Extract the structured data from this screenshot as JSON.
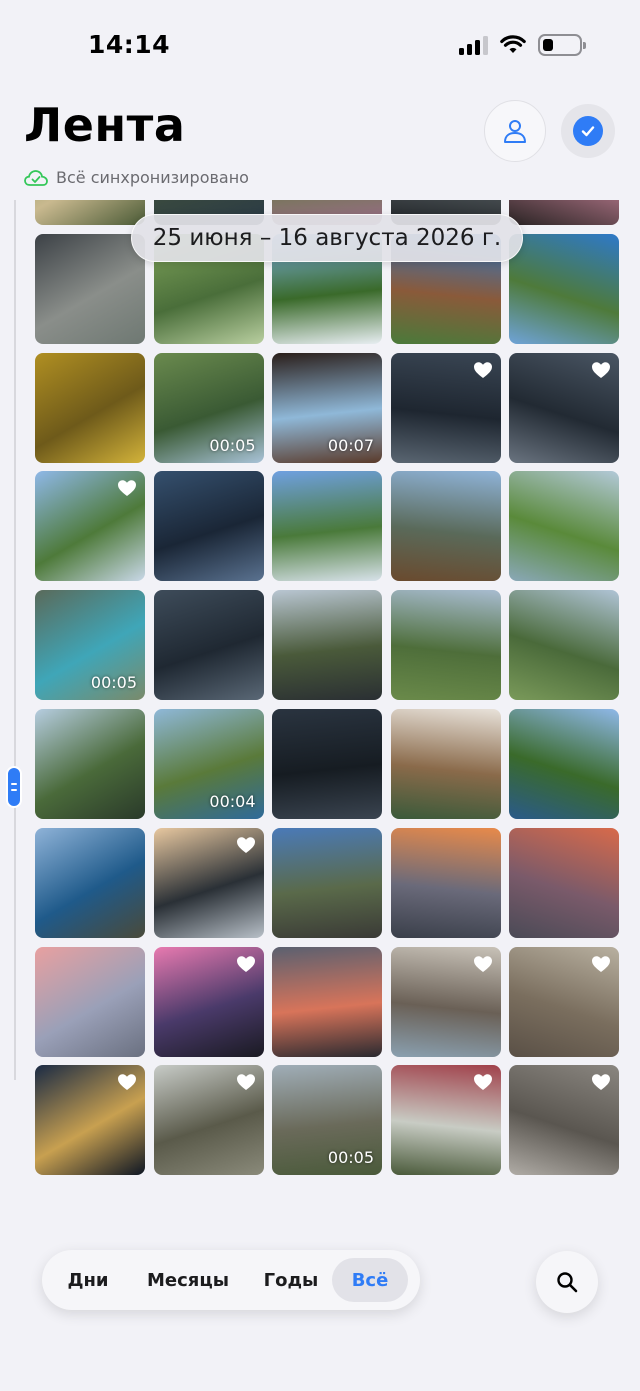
{
  "status_bar": {
    "time": "14:14"
  },
  "header": {
    "title": "Лента",
    "sync_text": "Всё синхронизировано"
  },
  "date_range": "25 июня – 16 августа 2026 г.",
  "tabs": [
    {
      "label": "Дни",
      "active": false
    },
    {
      "label": "Месяцы",
      "active": false
    },
    {
      "label": "Годы",
      "active": false
    },
    {
      "label": "Всё",
      "active": true
    }
  ],
  "colors": {
    "accent": "#2f7cf6",
    "sync_green": "#34c759"
  },
  "photos": [
    {
      "subject": "cafe terrace",
      "colors": [
        "#6f8a4e",
        "#c9b98f",
        "#4a5a36"
      ]
    },
    {
      "subject": "coastal cliffs",
      "colors": [
        "#b7c6d3",
        "#3a4a3e",
        "#2a3a46"
      ]
    },
    {
      "subject": "wildflowers",
      "colors": [
        "#c9c2cf",
        "#6b7a4a",
        "#9b6b8a"
      ]
    },
    {
      "subject": "car window view",
      "colors": [
        "#e7ecef",
        "#555c60",
        "#1e2225"
      ]
    },
    {
      "subject": "sunset sky",
      "colors": [
        "#e28a5c",
        "#9e6a7a",
        "#2a2424"
      ]
    },
    {
      "subject": "stone window flowers",
      "colors": [
        "#3c4146",
        "#8a8e8a",
        "#6e7872"
      ]
    },
    {
      "subject": "green valley",
      "colors": [
        "#7fa35a",
        "#4a6e3a",
        "#b9cfa0"
      ]
    },
    {
      "subject": "palm tree cliffs",
      "colors": [
        "#7fb3e8",
        "#3a6a2a",
        "#e8eef2"
      ]
    },
    {
      "subject": "plant and ocean",
      "colors": [
        "#2f77c4",
        "#8a5a3a",
        "#4a7a3a"
      ]
    },
    {
      "subject": "sea cliffs",
      "colors": [
        "#2e79c9",
        "#4e7a3a",
        "#6fa3d8"
      ]
    },
    {
      "subject": "yellow flowers",
      "colors": [
        "#b08f22",
        "#6e5a1a",
        "#d3b33a"
      ]
    },
    {
      "subject": "mountain valley",
      "colors": [
        "#6a8a4e",
        "#3a5a34",
        "#a9c3d8"
      ],
      "duration": "00:05"
    },
    {
      "subject": "view through window",
      "colors": [
        "#2a1e1a",
        "#8fb8d8",
        "#5a3a2a"
      ],
      "duration": "00:07"
    },
    {
      "subject": "night sky",
      "colors": [
        "#3a4654",
        "#1e2630",
        "#5a6672"
      ],
      "liked": true
    },
    {
      "subject": "milky way",
      "colors": [
        "#4a5664",
        "#222a33",
        "#6a7480"
      ],
      "liked": true
    },
    {
      "subject": "alpine village",
      "colors": [
        "#8fb8e8",
        "#4e7a3a",
        "#c9d8e8"
      ],
      "liked": true
    },
    {
      "subject": "milky way mountains",
      "colors": [
        "#35506e",
        "#1a2636",
        "#5a7290"
      ]
    },
    {
      "subject": "alpine meadow",
      "colors": [
        "#6fa0e0",
        "#4a7a3a",
        "#d8e2ea"
      ]
    },
    {
      "subject": "waterfall town",
      "colors": [
        "#8fb3d8",
        "#5a6a5a",
        "#6a4a2e"
      ]
    },
    {
      "subject": "green hills",
      "colors": [
        "#b3c9d8",
        "#5a8a3a",
        "#8aa8b8"
      ]
    },
    {
      "subject": "turquoise lake",
      "colors": [
        "#5a6a5a",
        "#3fa6b8",
        "#7a8a6a"
      ],
      "duration": "00:05"
    },
    {
      "subject": "star sky",
      "colors": [
        "#3e4c5a",
        "#1f2832",
        "#5a6876"
      ]
    },
    {
      "subject": "coastal cliff",
      "colors": [
        "#b9c6d2",
        "#4a5a3a",
        "#2a2f33"
      ]
    },
    {
      "subject": "mountain ridge",
      "colors": [
        "#a8bcd0",
        "#4e6e3a",
        "#6a8a4a"
      ]
    },
    {
      "subject": "mountain valley",
      "colors": [
        "#b0c4d6",
        "#4a6a3a",
        "#7a9a5a"
      ]
    },
    {
      "subject": "mountains with car",
      "colors": [
        "#b6cde0",
        "#4a6a3a",
        "#2a3a2a"
      ]
    },
    {
      "subject": "cliffs and bay",
      "colors": [
        "#8fb8d8",
        "#5a7a3a",
        "#2f6a9a"
      ],
      "duration": "00:04"
    },
    {
      "subject": "night sky",
      "colors": [
        "#2a3440",
        "#161c22",
        "#3a4450"
      ]
    },
    {
      "subject": "plates of food",
      "colors": [
        "#e8e2da",
        "#8a6a4a",
        "#3a5a3a"
      ]
    },
    {
      "subject": "ocean cliff",
      "colors": [
        "#8fb8e8",
        "#3a6a2a",
        "#2a5a8a"
      ]
    },
    {
      "subject": "bay with boats",
      "colors": [
        "#8fb3d8",
        "#1f5a8a",
        "#4a4a3a"
      ]
    },
    {
      "subject": "sea of clouds",
      "colors": [
        "#e8c8a0",
        "#2a3036",
        "#b8c0c8"
      ],
      "liked": true
    },
    {
      "subject": "villa with palms",
      "colors": [
        "#4a7ab8",
        "#5a6a4a",
        "#3a3a36"
      ]
    },
    {
      "subject": "orange sunset",
      "colors": [
        "#e88a4a",
        "#6a6a7a",
        "#3a3f4a"
      ]
    },
    {
      "subject": "red sunset",
      "colors": [
        "#d86a4a",
        "#7a5a6a",
        "#4a4a56"
      ]
    },
    {
      "subject": "pink sky",
      "colors": [
        "#e8a0a0",
        "#9aa0b8",
        "#6a7080"
      ]
    },
    {
      "subject": "sunset from terrace",
      "colors": [
        "#e87ab0",
        "#4a3a6a",
        "#1a1a22"
      ],
      "liked": true
    },
    {
      "subject": "dramatic sunset",
      "colors": [
        "#5a6070",
        "#d8745a",
        "#2a2a30"
      ]
    },
    {
      "subject": "classical colonnade",
      "colors": [
        "#c8c2b8",
        "#6a6056",
        "#8aa0b0"
      ],
      "liked": true
    },
    {
      "subject": "ornate facade",
      "colors": [
        "#b8b0a0",
        "#7a6e5e",
        "#5a5046"
      ],
      "liked": true
    },
    {
      "subject": "city at night",
      "colors": [
        "#1a2a44",
        "#c8a050",
        "#0e1624"
      ],
      "liked": true
    },
    {
      "subject": "white lichen",
      "colors": [
        "#c8ccc8",
        "#5a5a4a",
        "#8a8a7a"
      ],
      "liked": true
    },
    {
      "subject": "rocky coast",
      "colors": [
        "#a0aeb8",
        "#6a6a5a",
        "#4a5a3a"
      ],
      "duration": "00:05"
    },
    {
      "subject": "red berries moss",
      "colors": [
        "#a0404a",
        "#c8ccc4",
        "#4a5a3a"
      ],
      "liked": true
    },
    {
      "subject": "rock texture",
      "colors": [
        "#8a8680",
        "#5a5650",
        "#b0aca6"
      ],
      "liked": true
    }
  ]
}
